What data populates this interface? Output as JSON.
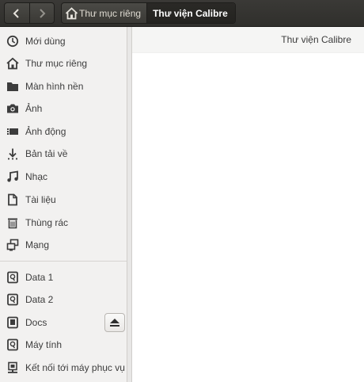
{
  "toolbar": {
    "back_icon": "chevron-left-icon",
    "forward_icon": "chevron-right-icon",
    "breadcrumbs": [
      {
        "label": "Thư mục riêng",
        "icon": "home-icon"
      },
      {
        "label": "Thư viện Calibre"
      }
    ]
  },
  "sidebar": {
    "places": [
      {
        "label": "Mới dùng",
        "icon": "clock-icon"
      },
      {
        "label": "Thư mục riêng",
        "icon": "home-icon"
      },
      {
        "label": "Màn hình nền",
        "icon": "folder-icon"
      },
      {
        "label": "Ảnh",
        "icon": "camera-icon"
      },
      {
        "label": "Ảnh động",
        "icon": "video-icon"
      },
      {
        "label": "Bản tải về",
        "icon": "download-icon"
      },
      {
        "label": "Nhạc",
        "icon": "music-icon"
      },
      {
        "label": "Tài liệu",
        "icon": "document-icon"
      },
      {
        "label": "Thùng rác",
        "icon": "trash-icon"
      },
      {
        "label": "Mạng",
        "icon": "network-icon"
      }
    ],
    "devices": [
      {
        "label": "Data 1",
        "icon": "drive-icon"
      },
      {
        "label": "Data 2",
        "icon": "drive-icon"
      },
      {
        "label": "Docs",
        "icon": "drive-icon"
      },
      {
        "label": "Máy tính",
        "icon": "drive-icon"
      },
      {
        "label": "Kết nối tới máy phục vụ",
        "icon": "server-icon"
      }
    ],
    "eject_icon": "eject-icon"
  },
  "main": {
    "header_text": "Thư viện Calibre"
  },
  "colors": {
    "toolbar": "#353431",
    "sidebar": "#f2f1f0",
    "text": "#3c3c3c"
  }
}
